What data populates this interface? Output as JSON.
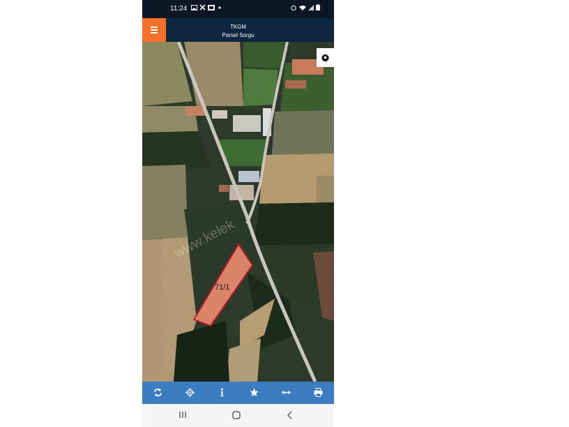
{
  "status_bar": {
    "time": "11:24",
    "notification_icons": [
      "image-icon",
      "fan-icon",
      "tv-icon",
      "dot-icon"
    ],
    "system_icons": [
      "alarm-icon",
      "wifi-icon",
      "signal-icon",
      "battery-icon"
    ]
  },
  "header": {
    "title_line1": "TKGM",
    "title_line2": "Parsel Sorgu",
    "menu_icon": "hamburger-menu-icon",
    "accent_color": "#f5702a",
    "bar_color": "#0f2640"
  },
  "map": {
    "parcel_label": "71/1",
    "watermark": "www.kelek",
    "parcel_fill": "#e88a6e",
    "parcel_border": "#c0182a",
    "settings_icon": "gear-icon"
  },
  "toolbar": {
    "color": "#3b7dc0",
    "buttons": [
      {
        "icon": "refresh-icon"
      },
      {
        "icon": "locate-icon"
      },
      {
        "icon": "info-icon"
      },
      {
        "icon": "star-icon"
      },
      {
        "icon": "measure-icon"
      },
      {
        "icon": "print-icon"
      }
    ]
  },
  "nav_bar": {
    "buttons": [
      "recent-apps-icon",
      "home-icon",
      "back-icon"
    ]
  }
}
